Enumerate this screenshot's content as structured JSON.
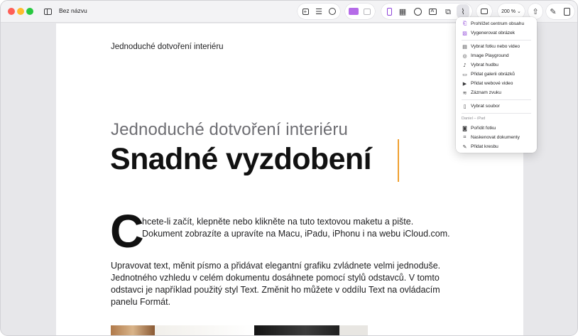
{
  "window": {
    "title": "Bez názvu"
  },
  "toolbar": {
    "zoom": "200 %",
    "zoom_chevron": "⌄"
  },
  "document": {
    "header": "Jednoduché dotvoření interiéru",
    "subtitle": "Jednoduché dotvoření interiéru",
    "title": "Snadné vyzdobení",
    "dropcap": "C",
    "paragraph1": "hcete-li začít, klepněte nebo klikněte na tuto textovou maketu a pište. Dokument zobrazíte a upravíte na Macu, iPadu, iPhonu i na webu iCloud.com.",
    "paragraph2": "Upravovat text, měnit písmo a přidávat elegantní grafiku zvládnete velmi jednoduše. Jednotného vzhledu v celém dokumentu dosáhnete pomocí stylů odstavců. V tomto odstavci je například použitý styl Text. Změnit ho můžete v oddílu Text na ovládacím panelu Formát."
  },
  "menu": {
    "items": [
      {
        "label": "Prohlížet centrum obsahu",
        "icon": "content-hub-icon",
        "glyph": "⎗"
      },
      {
        "label": "Vygenerovat obrázek",
        "icon": "image-generate-icon",
        "glyph": "▨"
      },
      {
        "label": "Vybrat fotku nebo video",
        "icon": "photo-library-icon",
        "glyph": "▤"
      },
      {
        "label": "Image Playground",
        "icon": "image-playground-icon",
        "glyph": "◎"
      },
      {
        "label": "Vybrat hudbu",
        "icon": "music-note-icon",
        "glyph": "♪"
      },
      {
        "label": "Přidat galerii obrázků",
        "icon": "image-gallery-icon",
        "glyph": "▭"
      },
      {
        "label": "Přidat webové video",
        "icon": "web-video-icon",
        "glyph": "▶"
      },
      {
        "label": "Záznam zvuku",
        "icon": "audio-waveform-icon",
        "glyph": "≋"
      },
      {
        "label": "Vybrat soubor",
        "icon": "document-icon",
        "glyph": "▯"
      },
      {
        "label": "Pořídit fotku",
        "icon": "camera-icon",
        "glyph": "◙"
      },
      {
        "label": "Naskenovat dokumenty",
        "icon": "scan-document-icon",
        "glyph": "⌗"
      },
      {
        "label": "Přidat kresbu",
        "icon": "pen-scribble-icon",
        "glyph": "✎"
      }
    ],
    "group_label": "Daniel – iPad"
  },
  "colors": {
    "accent": "#8e44d8",
    "cursor": "#f0a030",
    "traffic_red": "#fe5f57",
    "traffic_yellow": "#febc2e",
    "traffic_green": "#28c840"
  }
}
